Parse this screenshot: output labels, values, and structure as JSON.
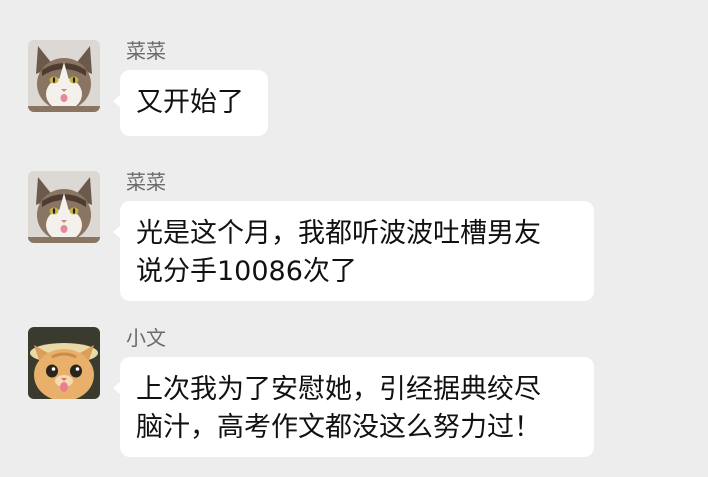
{
  "messages": [
    {
      "sender": "菜菜",
      "avatar_icon": "tabby-cat-avatar-icon",
      "lines": [
        "又开始了"
      ]
    },
    {
      "sender": "菜菜",
      "avatar_icon": "tabby-cat-avatar-icon",
      "lines": [
        "光是这个月，我都听波波吐槽男友",
        "说分手10086次了"
      ]
    },
    {
      "sender": "小文",
      "avatar_icon": "orange-kitten-avatar-icon",
      "lines": [
        "上次我为了安慰她，引经据典绞尽",
        "脑汁，高考作文都没这么努力过！"
      ]
    }
  ],
  "colors": {
    "background": "#ededed",
    "bubble": "#ffffff",
    "sender_text": "#6b6b6b",
    "message_text": "#111111"
  }
}
